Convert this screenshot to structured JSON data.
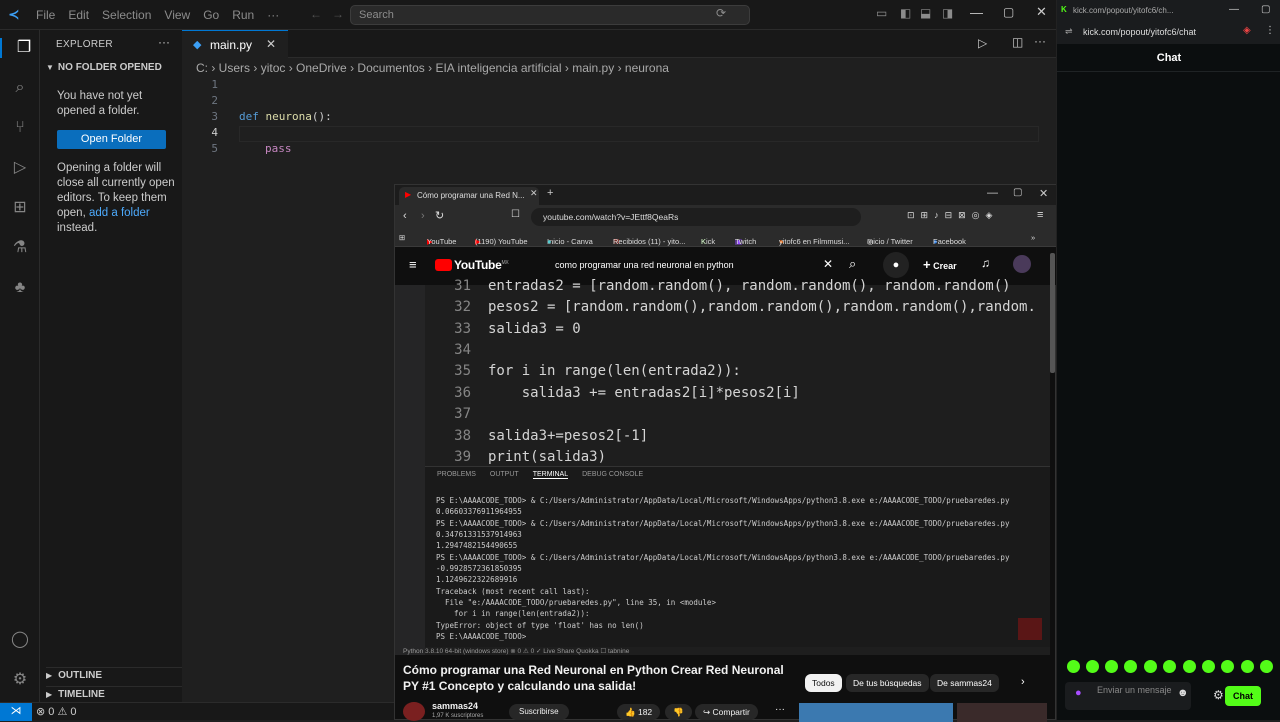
{
  "vscode": {
    "menu": [
      "File",
      "Edit",
      "Selection",
      "View",
      "Go",
      "Run",
      "···"
    ],
    "search_placeholder": "Search",
    "explorer_title": "EXPLORER",
    "no_folder": "NO FOLDER OPENED",
    "msg1": "You have not yet opened a folder.",
    "open_folder": "Open Folder",
    "msg2_a": "Opening a folder will close all currently open editors. To keep them open,",
    "msg2_link": "add a folder",
    "msg2_b": "instead.",
    "outline": "OUTLINE",
    "timeline": "TIMELINE",
    "tab": "main.py",
    "breadcrumb": [
      "C:",
      "Users",
      "yitoc",
      "OneDrive",
      "Documentos",
      "EIA inteligencia artificial",
      "main.py",
      "neurona"
    ],
    "lines": [
      "1",
      "2",
      "3",
      "4",
      "5"
    ],
    "code_def": "def",
    "code_fn": "neurona",
    "code_paren": "():",
    "code_pass": "pass",
    "status_errors": "0",
    "status_warnings": "0"
  },
  "browser": {
    "tab_title": "Cómo programar una Red N...",
    "url": "youtube.com/watch?v=JEttf8QeaRs",
    "bookmarks": [
      "YouTube",
      "(1190) YouTube",
      "Inicio - Canva",
      "Recibidos (11) - yito...",
      "Kick",
      "Twitch",
      "yitofc6 en Filmmusi...",
      "Inicio / Twitter",
      "Facebook"
    ],
    "yt_logo": "YouTube",
    "yt_logo_region": "MX",
    "search_query": "como programar una red neuronal en python",
    "create_label": "Crear",
    "video_code": [
      {
        "n": "31",
        "t": "entradas2 = [random.random(), random.random(), random.random()"
      },
      {
        "n": "32",
        "t": "pesos2 = [random.random(),random.random(),random.random(),random."
      },
      {
        "n": "33",
        "t": "salida3 = 0"
      },
      {
        "n": "34",
        "t": ""
      },
      {
        "n": "35",
        "t": "for i in range(len(entrada2)):"
      },
      {
        "n": "36",
        "t": "    salida3 += entradas2[i]*pesos2[i]"
      },
      {
        "n": "37",
        "t": ""
      },
      {
        "n": "38",
        "t": "salida3+=pesos2[-1]"
      },
      {
        "n": "39",
        "t": "print(salida3)"
      }
    ],
    "term_tabs": [
      "PROBLEMS",
      "OUTPUT",
      "TERMINAL",
      "DEBUG CONSOLE"
    ],
    "terminal": [
      "PS E:\\AAAACODE_TODO> & C:/Users/Administrator/AppData/Local/Microsoft/WindowsApps/python3.8.exe e:/AAAACODE_TODO/pruebaredes.py",
      "0.06603376911964955",
      "PS E:\\AAAACODE_TODO> & C:/Users/Administrator/AppData/Local/Microsoft/WindowsApps/python3.8.exe e:/AAAACODE_TODO/pruebaredes.py",
      "0.34761331537914963",
      "1.2947482154490655",
      "PS E:\\AAAACODE_TODO> & C:/Users/Administrator/AppData/Local/Microsoft/WindowsApps/python3.8.exe e:/AAAACODE_TODO/pruebaredes.py",
      "-0.9928572361850395",
      "1.1249622322689916",
      "Traceback (most recent call last):",
      "  File \"e:/AAAACODE_TODO/pruebaredes.py\", line 35, in <module>",
      "    for i in range(len(entrada2)):",
      "TypeError: object of type 'float' has no len()",
      "PS E:\\AAAACODE_TODO> "
    ],
    "video_status": "Python 3.8.10 64-bit (windows store)   ⊗ 0 ⚠ 0   ✓ Live Share   Quokka   ☐ tabnine",
    "video_title": "Cómo programar una Red Neuronal en Python Crear Red Neuronal PY #1 Concepto y calculando una salida!",
    "chips": [
      "Todos",
      "De tus búsquedas",
      "De sammas24"
    ],
    "channel": "sammas24",
    "subscribers": "1,97 K suscriptores",
    "subscribe": "Suscribirse",
    "likes": "182",
    "share": "Compartir"
  },
  "kick": {
    "window_title": "kick.com/popout/yitofc6/ch...",
    "url": "kick.com/popout/yitofc6/chat",
    "chat_header": "Chat",
    "input_placeholder": "Enviar un mensaje",
    "send": "Chat"
  }
}
